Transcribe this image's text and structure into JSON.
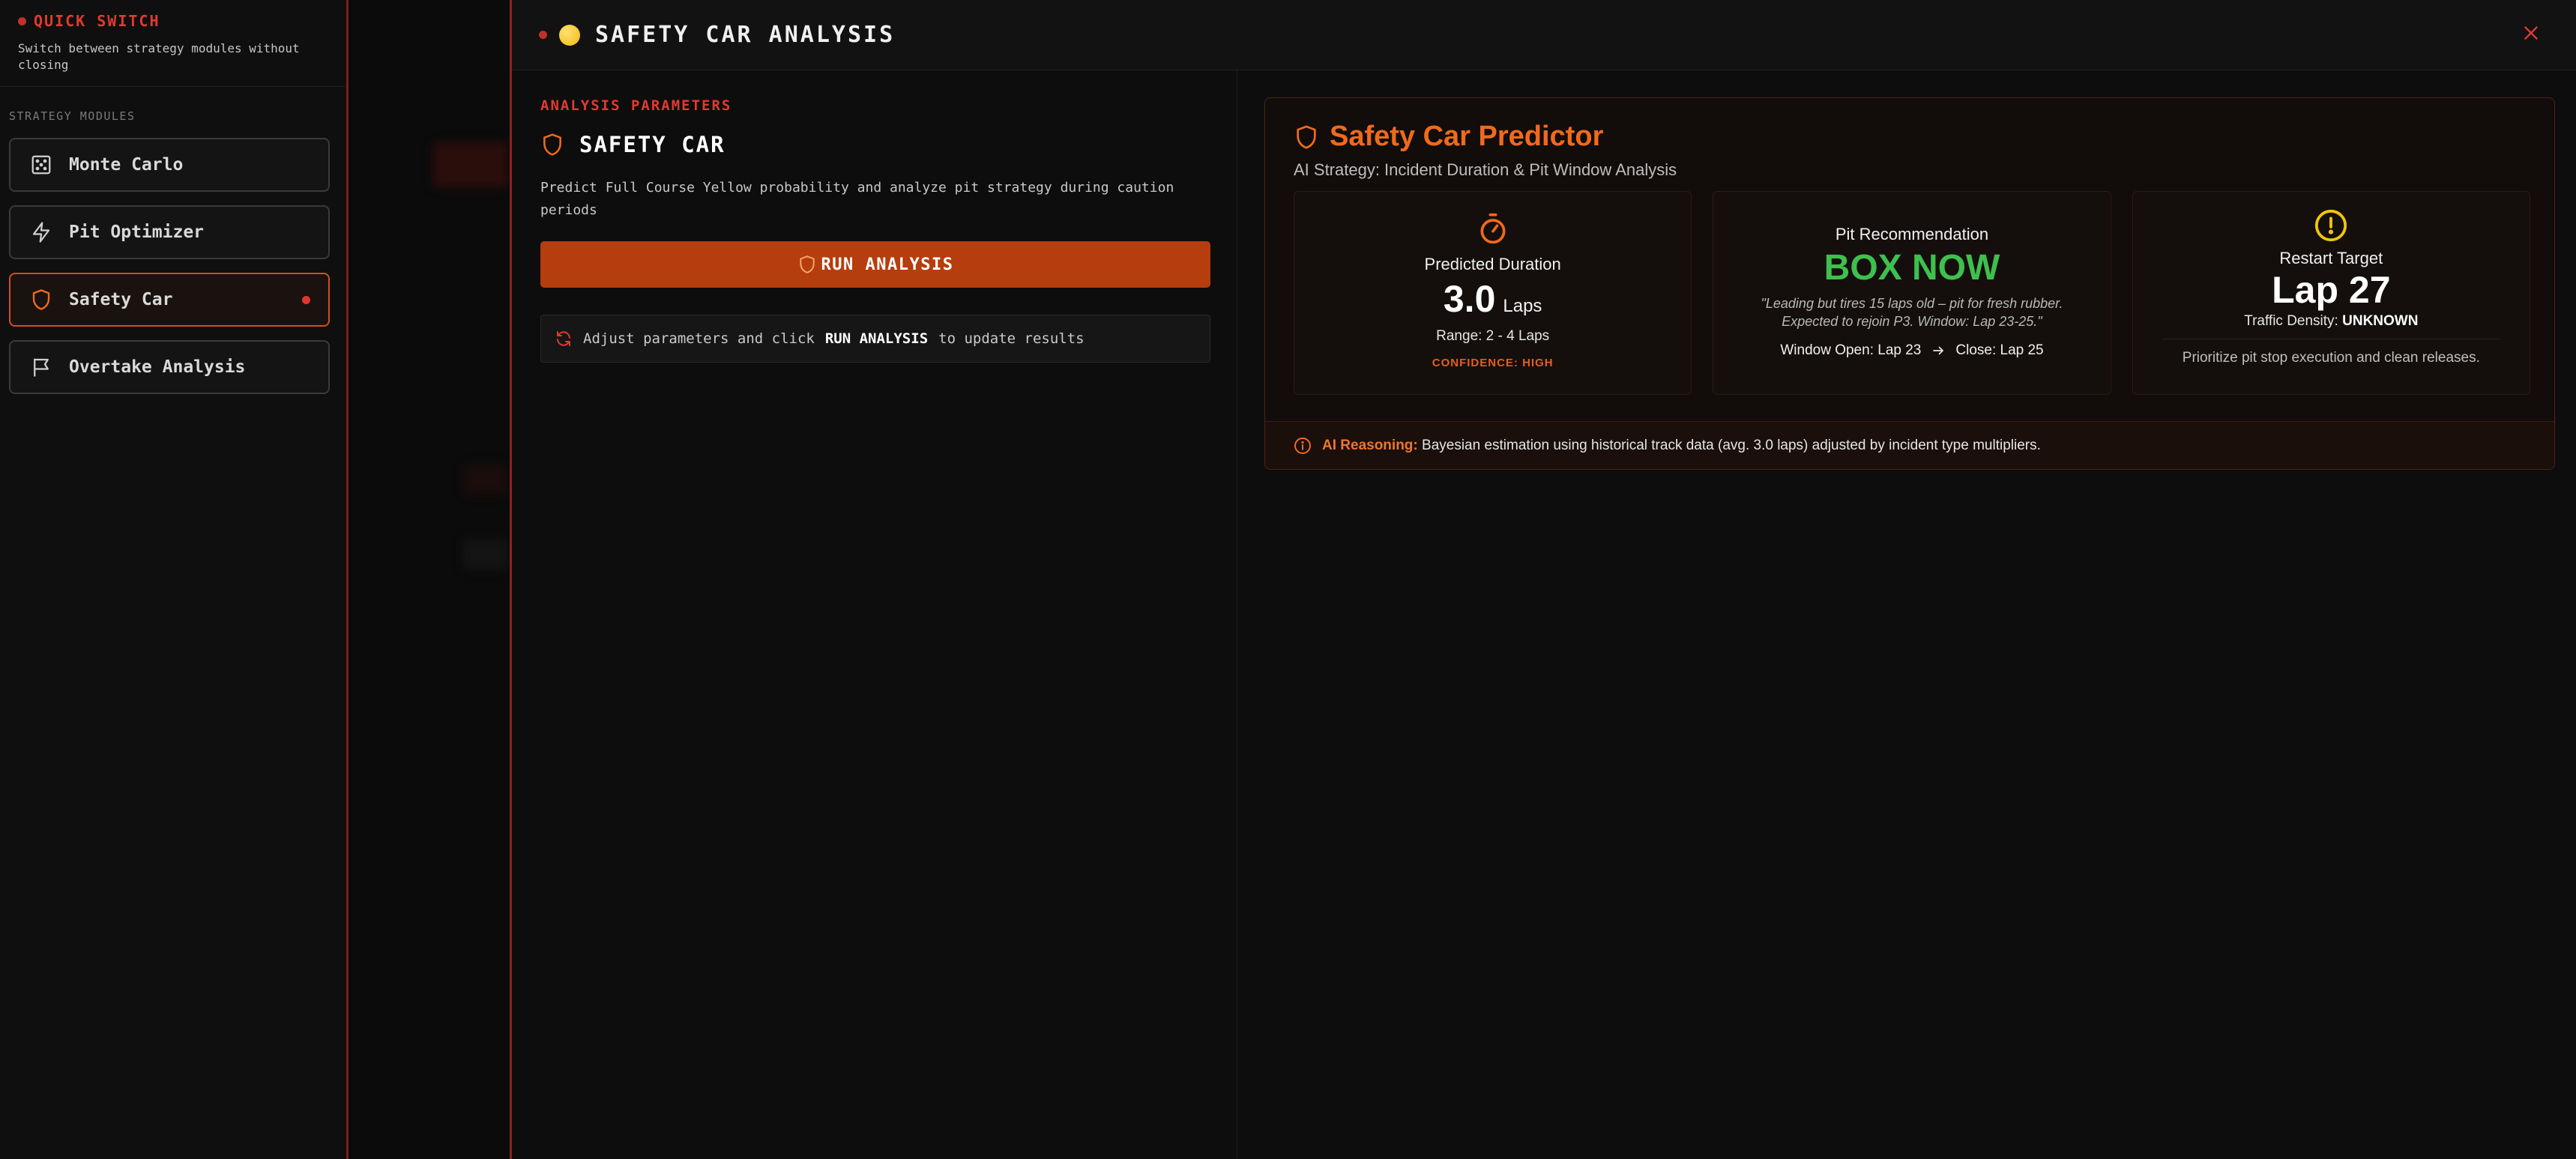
{
  "quick_switch": {
    "title": "QUICK SWITCH",
    "subtitle": "Switch between strategy modules without closing",
    "modules_label": "STRATEGY MODULES",
    "items": [
      {
        "label": "Monte Carlo",
        "icon": "dice-icon",
        "active": false
      },
      {
        "label": "Pit Optimizer",
        "icon": "lightning-icon",
        "active": false
      },
      {
        "label": "Safety Car",
        "icon": "shield-icon",
        "active": true
      },
      {
        "label": "Overtake Analysis",
        "icon": "flag-icon",
        "active": false
      }
    ]
  },
  "modal": {
    "title": "SAFETY CAR ANALYSIS",
    "close_icon": "close-icon"
  },
  "params": {
    "section_label": "ANALYSIS PARAMETERS",
    "title": "SAFETY CAR",
    "description": "Predict Full Course Yellow probability and analyze pit strategy during caution periods",
    "run_button": "RUN ANALYSIS",
    "hint_prefix": "Adjust parameters and click",
    "hint_bold": "RUN ANALYSIS",
    "hint_suffix": "to update results"
  },
  "predictor": {
    "title": "Safety Car Predictor",
    "subtitle": "AI Strategy: Incident Duration & Pit Window Analysis",
    "duration": {
      "label": "Predicted Duration",
      "value": "3.0",
      "unit": "Laps",
      "range": "Range: 2 - 4 Laps",
      "confidence": "CONFIDENCE: HIGH"
    },
    "pit": {
      "label": "Pit Recommendation",
      "value": "BOX NOW",
      "quote": "\"Leading but tires 15 laps old – pit for fresh rubber. Expected to rejoin P3. Window: Lap 23-25.\"",
      "window_open": "Window Open: Lap 23",
      "window_close": "Close: Lap 25"
    },
    "restart": {
      "label": "Restart Target",
      "value": "Lap 27",
      "traffic_label": "Traffic Density:",
      "traffic_value": "UNKNOWN",
      "note": "Prioritize pit stop execution and clean releases."
    },
    "reasoning_label": "AI Reasoning:",
    "reasoning_text": "Bayesian estimation using historical track data (avg. 3.0 laps) adjusted by incident type multipliers."
  },
  "colors": {
    "accent": "#f06a1c",
    "danger": "#e23a2f",
    "success": "#3fbf4e",
    "warning": "#f2c40c"
  }
}
